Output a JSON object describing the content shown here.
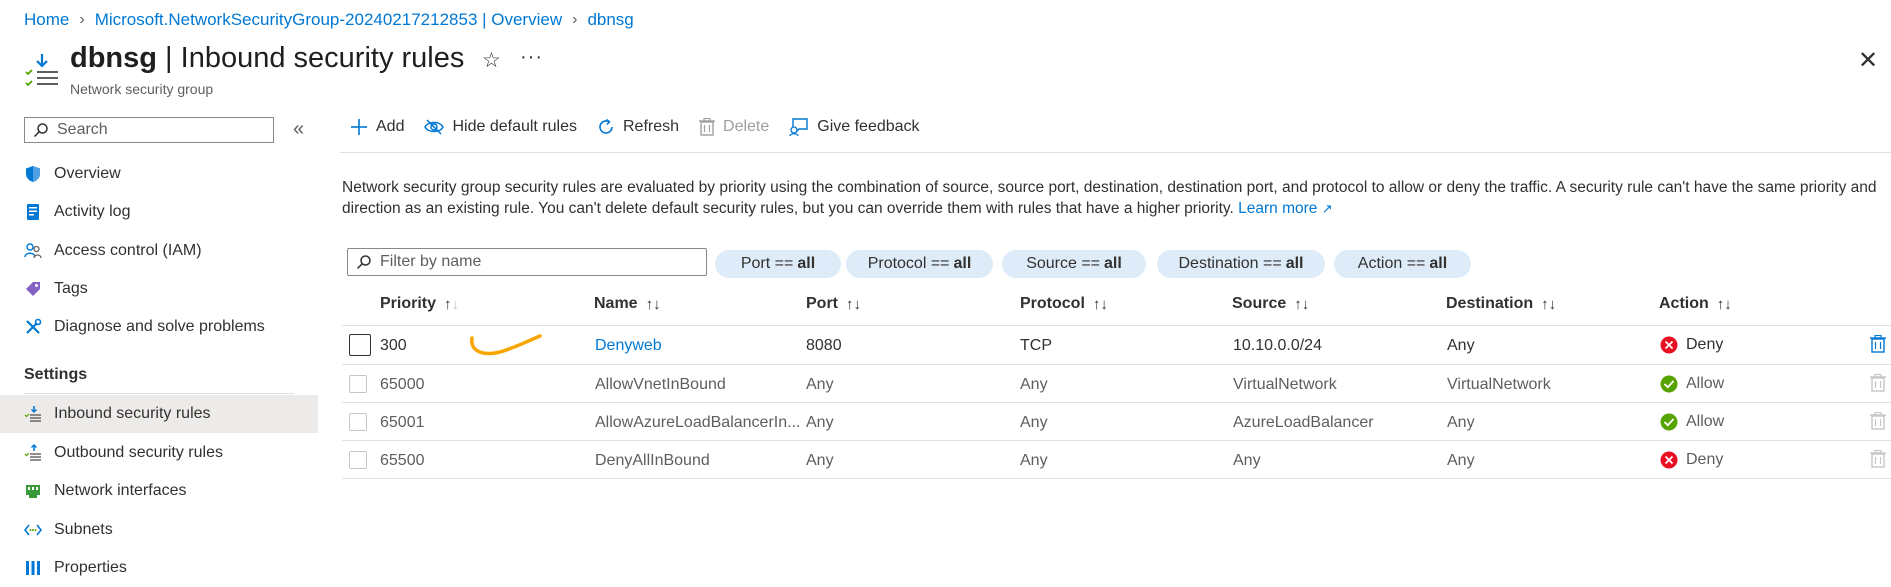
{
  "breadcrumb": {
    "home": "Home",
    "resource_group": "Microsoft.NetworkSecurityGroup-20240217212853 | Overview",
    "current": "dbnsg"
  },
  "header": {
    "title_bold": "dbnsg",
    "title_rest": " | Inbound security rules",
    "subtitle": "Network security group"
  },
  "sidebar": {
    "search_placeholder": "Search",
    "items": [
      {
        "label": "Overview",
        "icon": "shield-icon"
      },
      {
        "label": "Activity log",
        "icon": "activity-log-icon"
      },
      {
        "label": "Access control (IAM)",
        "icon": "people-icon"
      },
      {
        "label": "Tags",
        "icon": "tag-icon"
      },
      {
        "label": "Diagnose and solve problems",
        "icon": "wrench-icon"
      }
    ],
    "settings_label": "Settings",
    "settings_items": [
      {
        "label": "Inbound security rules",
        "icon": "inbound-rules-icon",
        "active": true
      },
      {
        "label": "Outbound security rules",
        "icon": "outbound-rules-icon"
      },
      {
        "label": "Network interfaces",
        "icon": "network-interface-icon"
      },
      {
        "label": "Subnets",
        "icon": "subnet-icon"
      },
      {
        "label": "Properties",
        "icon": "properties-icon"
      }
    ]
  },
  "toolbar": {
    "add": "Add",
    "hide_default": "Hide default rules",
    "refresh": "Refresh",
    "delete": "Delete",
    "feedback": "Give feedback"
  },
  "description": {
    "text": "Network security group security rules are evaluated by priority using the combination of source, source port, destination, destination port, and protocol to allow or deny the traffic. A security rule can't have the same priority and direction as an existing rule. You can't delete default security rules, but you can override them with rules that have a higher priority.",
    "learn_more": "Learn more"
  },
  "filters": {
    "name_placeholder": "Filter by name",
    "pills": [
      {
        "key": "Port ==",
        "value": "all"
      },
      {
        "key": "Protocol ==",
        "value": "all"
      },
      {
        "key": "Source ==",
        "value": "all"
      },
      {
        "key": "Destination ==",
        "value": "all"
      },
      {
        "key": "Action ==",
        "value": "all"
      }
    ]
  },
  "table": {
    "columns": [
      "Priority",
      "Name",
      "Port",
      "Protocol",
      "Source",
      "Destination",
      "Action"
    ],
    "rows": [
      {
        "priority": "300",
        "name": "Denyweb",
        "port": "8080",
        "protocol": "TCP",
        "source": "10.10.0.0/24",
        "destination": "Any",
        "action": "Deny"
      },
      {
        "priority": "65000",
        "name": "AllowVnetInBound",
        "port": "Any",
        "protocol": "Any",
        "source": "VirtualNetwork",
        "destination": "VirtualNetwork",
        "action": "Allow"
      },
      {
        "priority": "65001",
        "name": "AllowAzureLoadBalancerIn...",
        "port": "Any",
        "protocol": "Any",
        "source": "AzureLoadBalancer",
        "destination": "Any",
        "action": "Allow"
      },
      {
        "priority": "65500",
        "name": "DenyAllInBound",
        "port": "Any",
        "protocol": "Any",
        "source": "Any",
        "destination": "Any",
        "action": "Deny"
      }
    ]
  },
  "colors": {
    "link": "#0078d4",
    "deny": "#e81123",
    "allow": "#57a300",
    "pill_bg": "#deecf9",
    "annotation": "#f7a600"
  }
}
